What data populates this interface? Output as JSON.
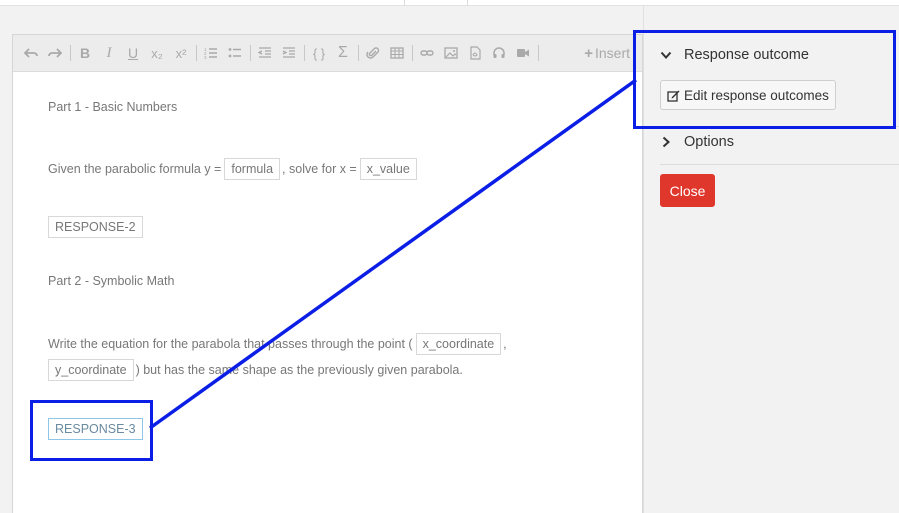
{
  "toolbar": {
    "insert_label": "Insert",
    "icons": [
      "undo-icon",
      "redo-icon",
      "bold-icon",
      "italic-icon",
      "underline-icon",
      "subscript-icon",
      "superscript-icon",
      "ordered-list-icon",
      "unordered-list-icon",
      "outdent-icon",
      "indent-icon",
      "code-icon",
      "sigma-icon",
      "attachment-icon",
      "table-icon",
      "link-icon",
      "image-icon",
      "pdf-icon",
      "audio-icon",
      "video-icon"
    ],
    "bold": "B",
    "italic": "I",
    "underline": "U",
    "subscript": "x₂",
    "superscript": "x²",
    "code": "{ }",
    "sigma": "Σ"
  },
  "content": {
    "part1_title": "Part 1 - Basic Numbers",
    "q1_text_a": "Given the parabolic formula y =",
    "q1_chip_formula": "formula",
    "q1_text_b": ", solve for x =",
    "q1_chip_x": "x_value",
    "response2": "RESPONSE-2",
    "part2_title": "Part 2 - Symbolic Math",
    "q2_text_a": "Write the equation for the parabola that passes through the point (",
    "q2_chip_xc": "x_coordinate",
    "q2_comma": ",",
    "q2_chip_yc": "y_coordinate",
    "q2_text_b": ") but has the same shape as the previously given parabola.",
    "response3": "RESPONSE-3"
  },
  "panel": {
    "response_outcome_label": "Response outcome",
    "edit_outcomes_label": "Edit response outcomes",
    "options_label": "Options",
    "close_label": "Close"
  },
  "colors": {
    "annotation": "#0a1ee6",
    "close_button": "#e0372c",
    "selected_chip_border": "#8ec6e8"
  }
}
